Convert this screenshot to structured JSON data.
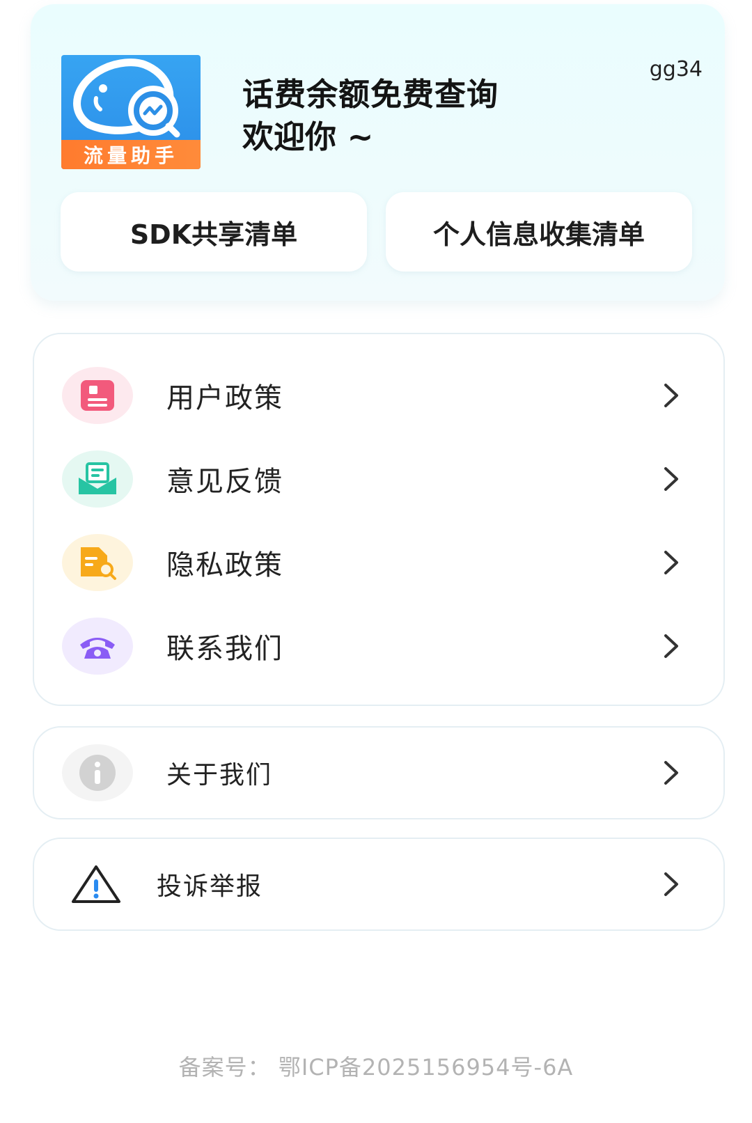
{
  "header": {
    "logo_text": "流量助手",
    "title": "话费余额免费查询",
    "subtitle": "欢迎你 ~",
    "version": "gg34",
    "buttons": [
      {
        "label": "SDK共享清单"
      },
      {
        "label": "个人信息收集清单"
      }
    ]
  },
  "menu": {
    "main_items": [
      {
        "label": "用户政策",
        "icon": "document-icon",
        "color": "#f25a7c"
      },
      {
        "label": "意见反馈",
        "icon": "feedback-envelope-icon",
        "color": "#27c4a3"
      },
      {
        "label": "隐私政策",
        "icon": "privacy-search-icon",
        "color": "#f7a91a"
      },
      {
        "label": "联系我们",
        "icon": "telephone-icon",
        "color": "#8a5cf5"
      }
    ],
    "about": {
      "label": "关于我们",
      "icon": "info-icon",
      "color": "#cfcfcf"
    },
    "report": {
      "label": "投诉举报",
      "icon": "warning-icon",
      "color": "#2a8bf0"
    }
  },
  "footer": {
    "icp": "备案号： 鄂ICP备2025156954号-6A"
  }
}
